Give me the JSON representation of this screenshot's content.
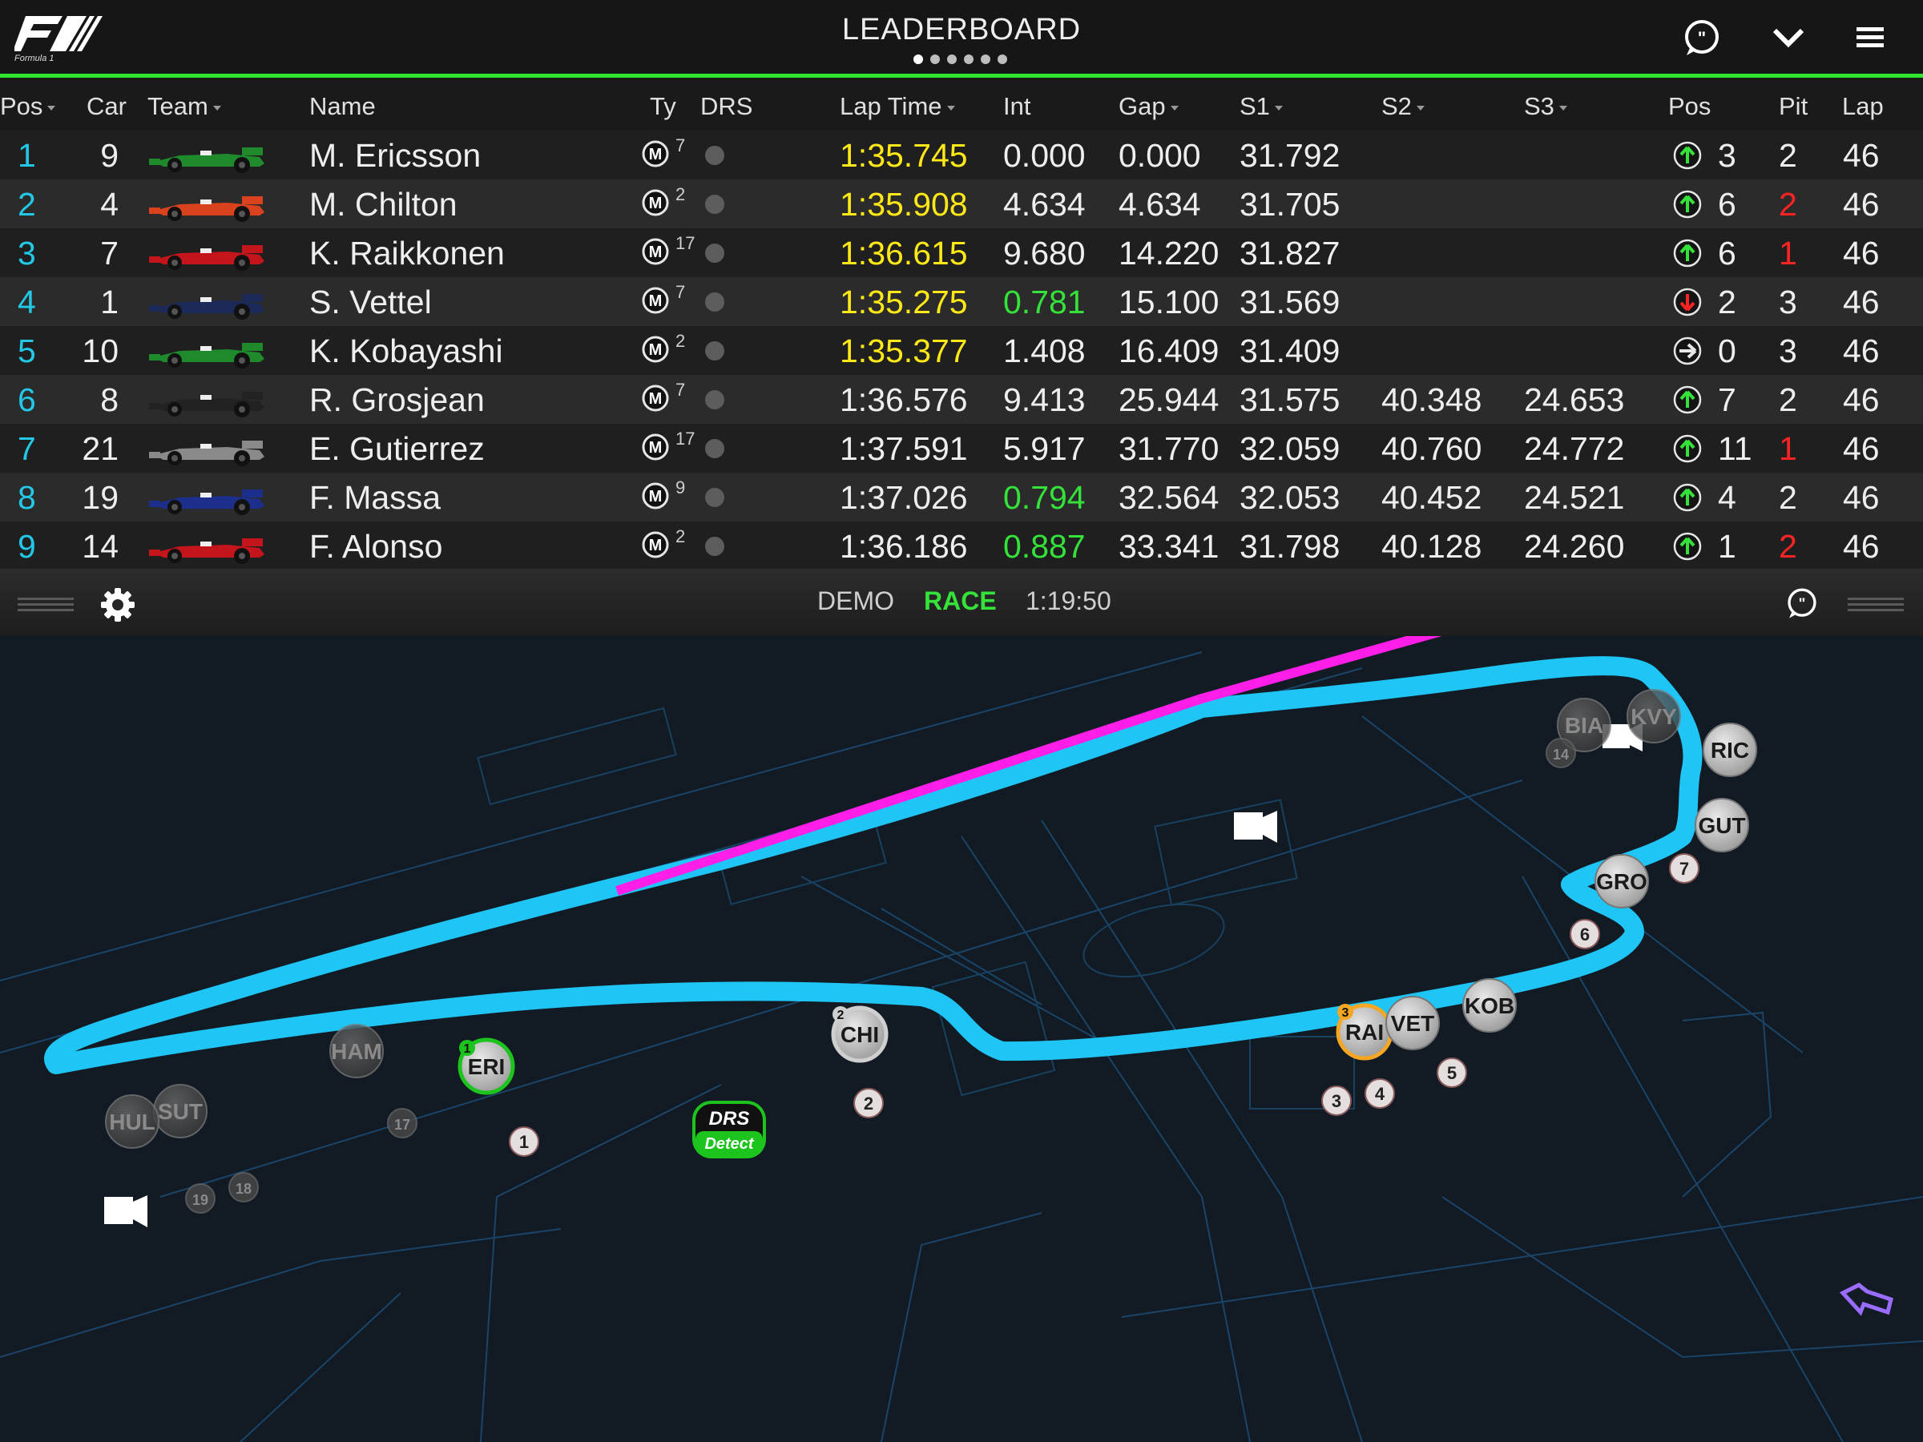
{
  "header": {
    "title": "LEADERBOARD",
    "page_count": 6,
    "active_page": 0
  },
  "columns": {
    "pos": "Pos",
    "car": "Car",
    "team": "Team",
    "name": "Name",
    "ty": "Ty",
    "drs": "DRS",
    "lap_time": "Lap Time",
    "int": "Int",
    "gap": "Gap",
    "s1": "S1",
    "s2": "S2",
    "s3": "S3",
    "pos_change": "Pos",
    "pit": "Pit",
    "lap": "Lap"
  },
  "rows": [
    {
      "pos": "1",
      "car": "9",
      "name": "M. Ericsson",
      "tyre": "M",
      "tyre_laps": "7",
      "lap_time": "1:35.745",
      "lap_color": "yel",
      "int": "0.000",
      "int_color": "",
      "gap": "0.000",
      "s1": "31.792",
      "s2": "",
      "s3": "",
      "trend": "up",
      "pos_change": "3",
      "pit": "2",
      "pit_color": "",
      "lap": "46",
      "team_color": "#1f8a2c"
    },
    {
      "pos": "2",
      "car": "4",
      "name": "M. Chilton",
      "tyre": "M",
      "tyre_laps": "2",
      "lap_time": "1:35.908",
      "lap_color": "yel",
      "int": "4.634",
      "int_color": "",
      "gap": "4.634",
      "s1": "31.705",
      "s2": "",
      "s3": "",
      "trend": "up",
      "pos_change": "6",
      "pit": "2",
      "pit_color": "red",
      "lap": "46",
      "team_color": "#d9421c"
    },
    {
      "pos": "3",
      "car": "7",
      "name": "K. Raikkonen",
      "tyre": "M",
      "tyre_laps": "17",
      "lap_time": "1:36.615",
      "lap_color": "yel",
      "int": "9.680",
      "int_color": "",
      "gap": "14.220",
      "s1": "31.827",
      "s2": "",
      "s3": "",
      "trend": "up",
      "pos_change": "6",
      "pit": "1",
      "pit_color": "red",
      "lap": "46",
      "team_color": "#c4151c"
    },
    {
      "pos": "4",
      "car": "1",
      "name": "S. Vettel",
      "tyre": "M",
      "tyre_laps": "7",
      "lap_time": "1:35.275",
      "lap_color": "yel",
      "int": "0.781",
      "int_color": "grn",
      "gap": "15.100",
      "s1": "31.569",
      "s2": "",
      "s3": "",
      "trend": "down",
      "pos_change": "2",
      "pit": "3",
      "pit_color": "",
      "lap": "46",
      "team_color": "#1c2a5a"
    },
    {
      "pos": "5",
      "car": "10",
      "name": "K. Kobayashi",
      "tyre": "M",
      "tyre_laps": "2",
      "lap_time": "1:35.377",
      "lap_color": "yel",
      "int": "1.408",
      "int_color": "",
      "gap": "16.409",
      "s1": "31.409",
      "s2": "",
      "s3": "",
      "trend": "same",
      "pos_change": "0",
      "pit": "3",
      "pit_color": "",
      "lap": "46",
      "team_color": "#1f8a2c"
    },
    {
      "pos": "6",
      "car": "8",
      "name": "R. Grosjean",
      "tyre": "M",
      "tyre_laps": "7",
      "lap_time": "1:36.576",
      "lap_color": "",
      "int": "9.413",
      "int_color": "",
      "gap": "25.944",
      "s1": "31.575",
      "s2": "40.348",
      "s3": "24.653",
      "trend": "up",
      "pos_change": "7",
      "pit": "2",
      "pit_color": "",
      "lap": "46",
      "team_color": "#222222"
    },
    {
      "pos": "7",
      "car": "21",
      "name": "E. Gutierrez",
      "tyre": "M",
      "tyre_laps": "17",
      "lap_time": "1:37.591",
      "lap_color": "",
      "int": "5.917",
      "int_color": "",
      "gap": "31.770",
      "s1": "32.059",
      "s2": "40.760",
      "s3": "24.772",
      "trend": "up",
      "pos_change": "11",
      "pit": "1",
      "pit_color": "red",
      "lap": "46",
      "team_color": "#8a8a8a"
    },
    {
      "pos": "8",
      "car": "19",
      "name": "F. Massa",
      "tyre": "M",
      "tyre_laps": "9",
      "lap_time": "1:37.026",
      "lap_color": "",
      "int": "0.794",
      "int_color": "grn",
      "gap": "32.564",
      "s1": "32.053",
      "s2": "40.452",
      "s3": "24.521",
      "trend": "up",
      "pos_change": "4",
      "pit": "2",
      "pit_color": "",
      "lap": "46",
      "team_color": "#1c2f8c"
    },
    {
      "pos": "9",
      "car": "14",
      "name": "F. Alonso",
      "tyre": "M",
      "tyre_laps": "2",
      "lap_time": "1:36.186",
      "lap_color": "",
      "int": "0.887",
      "int_color": "grn",
      "gap": "33.341",
      "s1": "31.798",
      "s2": "40.128",
      "s3": "24.260",
      "trend": "up",
      "pos_change": "1",
      "pit": "2",
      "pit_color": "red",
      "lap": "46",
      "team_color": "#c4151c"
    }
  ],
  "status_bar": {
    "mode": "DEMO",
    "session": "RACE",
    "clock": "1:19:50"
  },
  "track_map": {
    "drs_badge_top": "DRS",
    "drs_badge_bottom": "Detect",
    "drivers": [
      "ERI",
      "CHI",
      "RAI",
      "VET",
      "KOB",
      "GRO",
      "GUT",
      "RIC",
      "KVY",
      "BIA",
      "HAM",
      "SUT",
      "HUL"
    ],
    "driver_badges": [
      "1",
      "2",
      "3"
    ],
    "markers": [
      "1",
      "2",
      "3",
      "4",
      "5",
      "6",
      "7",
      "17",
      "18",
      "19",
      "14"
    ]
  },
  "colors": {
    "accent_green": "#2ee62e",
    "position_blue": "#22c8e6",
    "fastest_yellow": "#ffe817",
    "track": "#1ec5f5",
    "drs_zone": "#ff1ee8"
  }
}
